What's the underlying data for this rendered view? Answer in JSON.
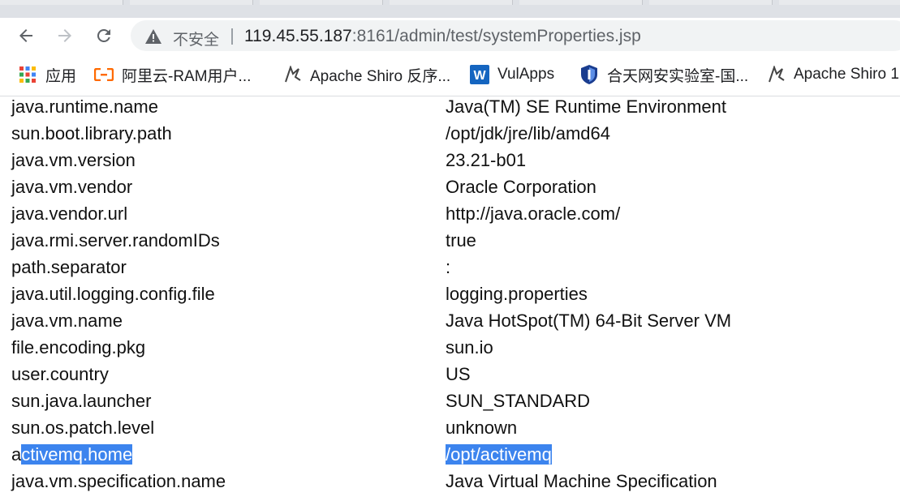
{
  "browser": {
    "security_label": "不安全",
    "url_host": "119.45.55.187",
    "url_rest": ":8161/admin/test/systemProperties.jsp"
  },
  "bookmarks": [
    {
      "label": "应用",
      "icon": "apps-grid-icon"
    },
    {
      "label": "阿里云-RAM用户...",
      "icon": "aliyun-icon"
    },
    {
      "label": "Apache Shiro 反序...",
      "icon": "shiro-icon"
    },
    {
      "label": "VulApps",
      "icon": "w-logo-icon"
    },
    {
      "label": "合天网安实验室-国...",
      "icon": "shield-icon"
    },
    {
      "label": "Apache Shiro 1",
      "icon": "shiro-icon"
    }
  ],
  "properties": [
    {
      "key": "java.runtime.name",
      "value": "Java(TM) SE Runtime Environment"
    },
    {
      "key": "sun.boot.library.path",
      "value": "/opt/jdk/jre/lib/amd64"
    },
    {
      "key": "java.vm.version",
      "value": "23.21-b01"
    },
    {
      "key": "java.vm.vendor",
      "value": "Oracle Corporation"
    },
    {
      "key": "java.vendor.url",
      "value": "http://java.oracle.com/"
    },
    {
      "key": "java.rmi.server.randomIDs",
      "value": "true"
    },
    {
      "key": "path.separator",
      "value": ":"
    },
    {
      "key": "java.util.logging.config.file",
      "value": "logging.properties"
    },
    {
      "key": "java.vm.name",
      "value": "Java HotSpot(TM) 64-Bit Server VM"
    },
    {
      "key": "file.encoding.pkg",
      "value": "sun.io"
    },
    {
      "key": "user.country",
      "value": "US"
    },
    {
      "key": "sun.java.launcher",
      "value": "SUN_STANDARD"
    },
    {
      "key": "sun.os.patch.level",
      "value": "unknown"
    },
    {
      "key_prefix": "a",
      "key_highlighted": "ctivemq.home",
      "value_highlighted": "/opt/activemq"
    },
    {
      "key": "java.vm.specification.name",
      "value": "Java Virtual Machine Specification"
    }
  ],
  "colors": {
    "selection": "#3c84ee",
    "toolbar_bg": "#ffffff",
    "omnibox_bg": "#f1f3f4"
  }
}
